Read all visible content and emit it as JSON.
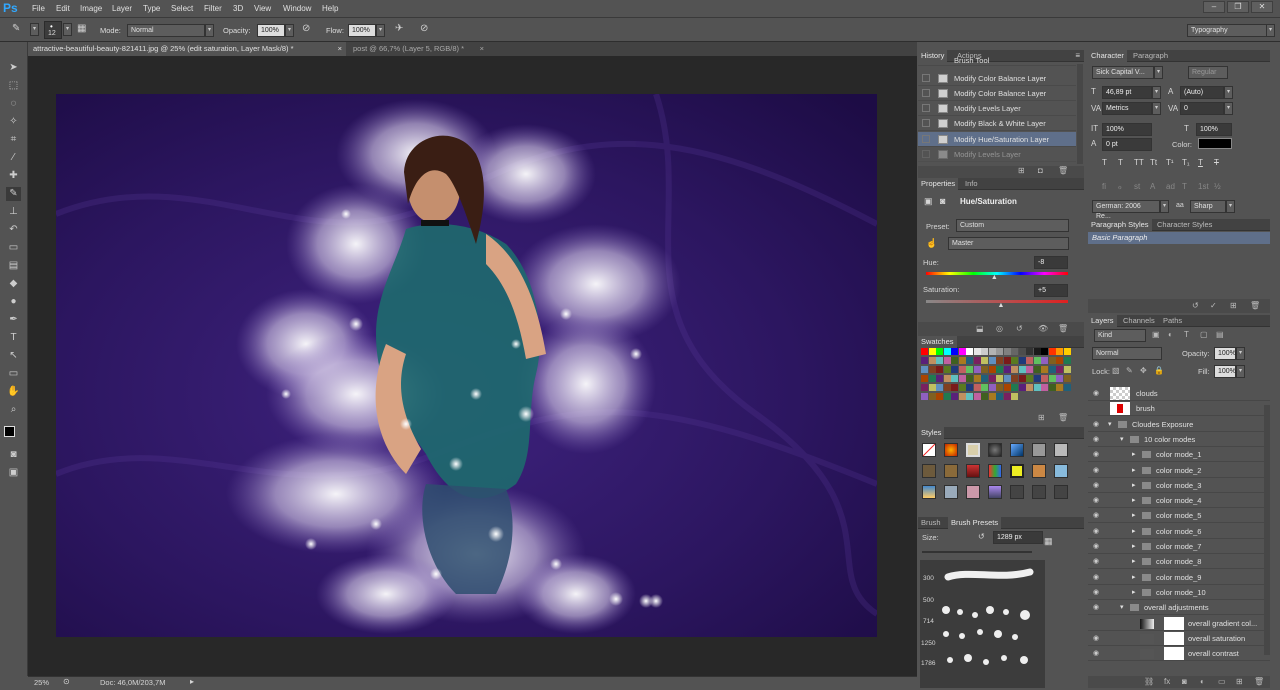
{
  "app": {
    "logo": "Ps",
    "menu": [
      "File",
      "Edit",
      "Image",
      "Layer",
      "Type",
      "Select",
      "Filter",
      "3D",
      "View",
      "Window",
      "Help"
    ],
    "window_buttons": [
      "–",
      "❐",
      "✕"
    ],
    "workspace": "Typography"
  },
  "options": {
    "brush_size": "12",
    "mode_label": "Mode:",
    "mode": "Normal",
    "opacity_label": "Opacity:",
    "opacity": "100%",
    "flow_label": "Flow:",
    "flow": "100%"
  },
  "tabs": [
    "attractive-beautiful-beauty-821411.jpg @ 25% (edit saturation, Layer Mask/8) *",
    "post @ 66,7% (Layer 5, RGB/8) *"
  ],
  "tab_close": "×",
  "status": {
    "zoom": "25%",
    "doc": "Doc: 46,0M/203,7M"
  },
  "history": {
    "tabs": [
      "History",
      "Actions"
    ],
    "items": [
      "Brush Tool",
      "Modify Color Balance Layer",
      "Modify Color Balance Layer",
      "Modify Levels Layer",
      "Modify Black & White Layer",
      "Modify Hue/Saturation Layer",
      "Modify Levels Layer"
    ],
    "selected": 5
  },
  "properties": {
    "tabs": [
      "Properties",
      "Info"
    ],
    "title": "Hue/Saturation",
    "preset_label": "Preset:",
    "preset": "Custom",
    "channel": "Master",
    "hue_label": "Hue:",
    "hue": "-8",
    "hue_value": -8,
    "sat_label": "Saturation:",
    "sat": "+5",
    "sat_value": 5
  },
  "swatches_title": "Swatches",
  "swatch_colors": [
    "#ff0000",
    "#ffff00",
    "#00ff00",
    "#00ffff",
    "#0000ff",
    "#ff00ff",
    "#ffffff",
    "#e6e6e6",
    "#cccccc",
    "#b3b3b3",
    "#999999",
    "#808080",
    "#666666",
    "#4d4d4d",
    "#333333",
    "#1a1a1a",
    "#000000",
    "#ff3300",
    "#ff9900",
    "#ffcc00"
  ],
  "styles_title": "Styles",
  "brush": {
    "tabs": [
      "Brush",
      "Brush Presets"
    ],
    "size_label": "Size:",
    "size": "1289 px",
    "preset_sizes": [
      "300",
      "500",
      "714",
      "1250",
      "1786"
    ]
  },
  "character": {
    "tabs": [
      "Character",
      "Paragraph"
    ],
    "font": "Sick Capital V...",
    "style": "Regular",
    "size": "46,89 pt",
    "leading": "(Auto)",
    "kerning": "Metrics",
    "tracking": "0",
    "vscale": "100%",
    "hscale": "100%",
    "baseline": "0 pt",
    "color_label": "Color:",
    "language": "German: 2006 Re...",
    "aa": "Sharp",
    "type_buttons": [
      "T",
      "T",
      "TT",
      "Tt",
      "T¹",
      "T₁",
      "T",
      "T"
    ],
    "ot_buttons": [
      "fi",
      "ℴ",
      "st",
      "A",
      "ad",
      "T",
      "1st",
      "½"
    ]
  },
  "paragraph_styles": {
    "tabs": [
      "Paragraph Styles",
      "Character Styles"
    ],
    "items": [
      "Basic Paragraph"
    ]
  },
  "layers": {
    "tabs": [
      "Layers",
      "Channels",
      "Paths"
    ],
    "filter": "Kind",
    "blend": "Normal",
    "opacity_label": "Opacity:",
    "opacity": "100%",
    "lock_label": "Lock:",
    "fill_label": "Fill:",
    "fill": "100%",
    "items": [
      {
        "name": "clouds",
        "indent": 0,
        "type": "layer"
      },
      {
        "name": "brush",
        "indent": 0,
        "type": "layer"
      },
      {
        "name": "Cloudes Exposure",
        "indent": 0,
        "type": "group"
      },
      {
        "name": "10 color modes",
        "indent": 1,
        "type": "group"
      },
      {
        "name": "color mode_1",
        "indent": 2,
        "type": "group"
      },
      {
        "name": "color mode_2",
        "indent": 2,
        "type": "group"
      },
      {
        "name": "color mode_3",
        "indent": 2,
        "type": "group"
      },
      {
        "name": "color mode_4",
        "indent": 2,
        "type": "group"
      },
      {
        "name": "color mode_5",
        "indent": 2,
        "type": "group"
      },
      {
        "name": "color mode_6",
        "indent": 2,
        "type": "group"
      },
      {
        "name": "color mode_7",
        "indent": 2,
        "type": "group"
      },
      {
        "name": "color mode_8",
        "indent": 2,
        "type": "group"
      },
      {
        "name": "color mode_9",
        "indent": 2,
        "type": "group"
      },
      {
        "name": "color mode_10",
        "indent": 2,
        "type": "group"
      },
      {
        "name": "overall adjustments",
        "indent": 1,
        "type": "group"
      },
      {
        "name": "overall gradient col...",
        "indent": 2,
        "type": "adj"
      },
      {
        "name": "overall saturation",
        "indent": 2,
        "type": "adj"
      },
      {
        "name": "overall contrast",
        "indent": 2,
        "type": "adj"
      }
    ]
  }
}
